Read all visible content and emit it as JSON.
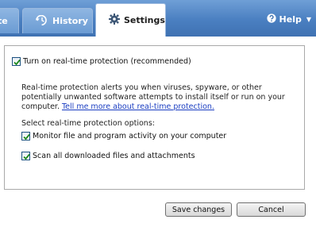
{
  "tabs": {
    "update": {
      "label": "te"
    },
    "history": {
      "label": "History",
      "icon": "history-icon"
    },
    "settings": {
      "label": "Settings",
      "icon": "gear-icon"
    }
  },
  "help": {
    "label": "Help",
    "icon": "help-icon"
  },
  "settings": {
    "realtime_label": "Turn on real-time protection (recommended)",
    "realtime_checked": true,
    "description": "Real-time protection alerts you when viruses, spyware, or other potentially unwanted software attempts to install itself or run on your computer. ",
    "learn_more_link": "Tell me more about real-time protection.",
    "options_heading": "Select real-time protection options:",
    "options": [
      {
        "label": "Monitor file and program activity on your computer",
        "checked": true
      },
      {
        "label": "Scan all downloaded files and attachments",
        "checked": true
      }
    ]
  },
  "buttons": {
    "save": "Save changes",
    "cancel": "Cancel"
  },
  "colors": {
    "tabbar": "#4a7fc1",
    "link": "#1a3dc1",
    "checkmark": "#1f8a1f"
  }
}
